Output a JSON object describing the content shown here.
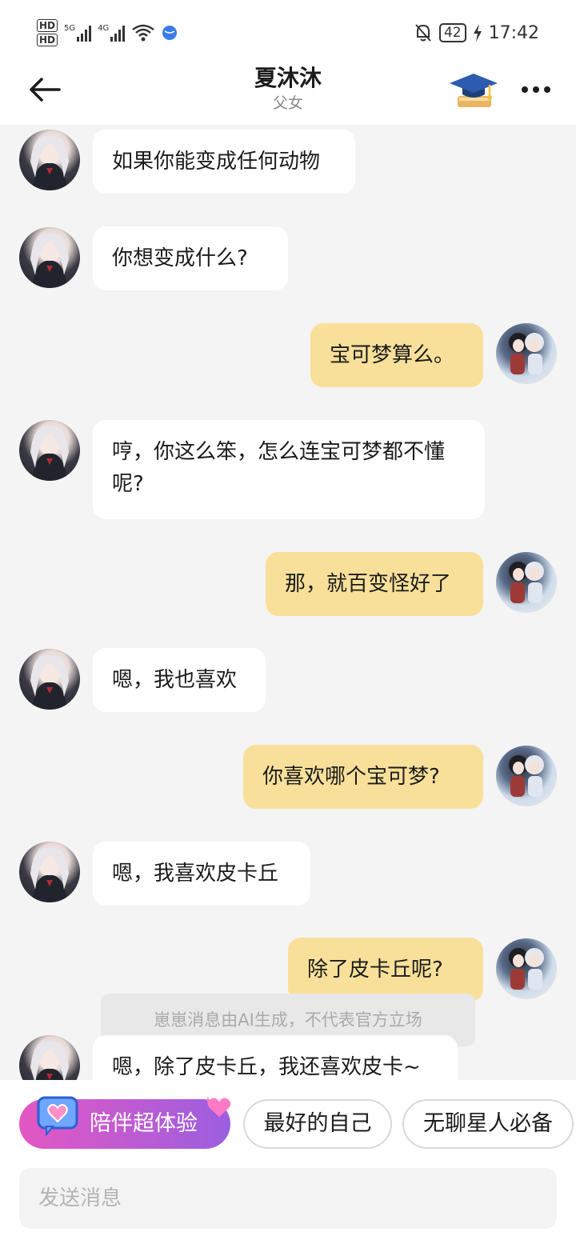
{
  "status_bar": {
    "hd1": "HD",
    "hd2": "HD",
    "net1": "5G",
    "net2": "4G",
    "battery": "42",
    "time": "17:42"
  },
  "header": {
    "title": "夏沐沐",
    "subtitle": "父女",
    "icons": [
      "back-arrow-icon",
      "graduation-cap-icon",
      "more-icon"
    ]
  },
  "messages": [
    {
      "from": "bot",
      "text": "如果你能变成任何动物"
    },
    {
      "from": "bot",
      "text": "你想变成什么?"
    },
    {
      "from": "user",
      "text": "宝可梦算么。"
    },
    {
      "from": "bot",
      "text": "哼，你这么笨，怎么连宝可梦都不懂呢?"
    },
    {
      "from": "user",
      "text": "那，就百变怪好了"
    },
    {
      "from": "bot",
      "text": "嗯，我也喜欢"
    },
    {
      "from": "user",
      "text": "你喜欢哪个宝可梦?"
    },
    {
      "from": "bot",
      "text": "嗯，我喜欢皮卡丘"
    },
    {
      "from": "user",
      "text": "除了皮卡丘呢?"
    },
    {
      "from": "bot",
      "text": "嗯，除了皮卡丘，我还喜欢皮卡~"
    }
  ],
  "disclaimer": "崽崽消息由AI生成，不代表官方立场",
  "chips": {
    "promo": "陪伴超体验",
    "chip1": "最好的自己",
    "chip2": "无聊星人必备"
  },
  "input": {
    "placeholder": "发送消息"
  },
  "colors": {
    "user_bubble": "#f8e09a",
    "bot_bubble": "#ffffff",
    "promo_gradient_start": "#e457c3",
    "promo_gradient_end": "#9b5fe0"
  }
}
